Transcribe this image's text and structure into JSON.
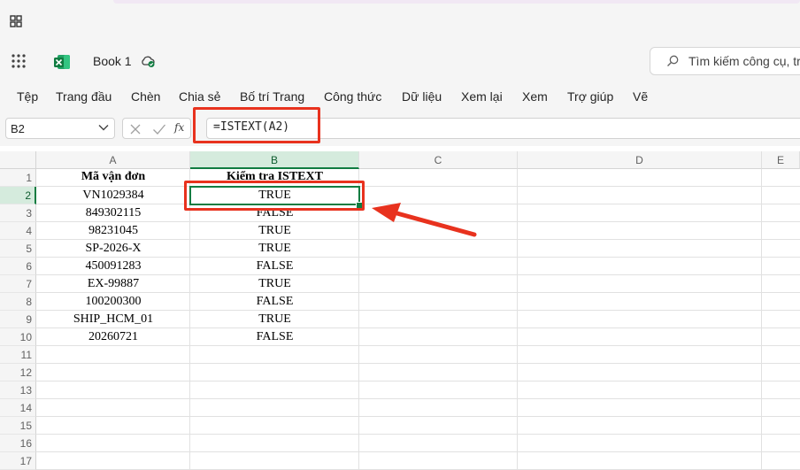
{
  "app": {
    "book_title": "Book 1",
    "search_placeholder": "Tìm kiếm công cụ, tr"
  },
  "ribbon": {
    "tabs": [
      "Tệp",
      "Trang đầu",
      "Chèn",
      "Chia sẻ",
      "Bố trí Trang",
      "Công thức",
      "Dữ liệu",
      "Xem lại",
      "Xem",
      "Trợ giúp",
      "Vẽ"
    ]
  },
  "formula_bar": {
    "name_box": "B2",
    "fx_label": "fx",
    "formula": "=ISTEXT(A2)"
  },
  "sheet": {
    "columns": [
      "A",
      "B",
      "C",
      "D",
      "E"
    ],
    "row_numbers": [
      "1",
      "2",
      "3",
      "4",
      "5",
      "6",
      "7",
      "8",
      "9",
      "10",
      "11",
      "12",
      "13",
      "14",
      "15",
      "16",
      "17"
    ],
    "header": [
      "Mã vận đơn",
      "Kiểm tra ISTEXT"
    ],
    "rows": [
      [
        "VN1029384",
        "TRUE"
      ],
      [
        "849302115",
        "FALSE"
      ],
      [
        "98231045",
        "TRUE"
      ],
      [
        "SP-2026-X",
        "TRUE"
      ],
      [
        "450091283",
        "FALSE"
      ],
      [
        "EX-99887",
        "TRUE"
      ],
      [
        "100200300",
        "FALSE"
      ],
      [
        "SHIP_HCM_01",
        "TRUE"
      ],
      [
        "20260721",
        "FALSE"
      ]
    ],
    "selected_cell": "B2"
  },
  "colors": {
    "accent_green": "#107c41",
    "annotation_red": "#e8321e",
    "chrome_bg": "#f5f5f5"
  },
  "icons": [
    "window-grid-icon",
    "waffle-icon",
    "excel-logo-icon",
    "cloud-sync-icon",
    "search-icon",
    "chevron-down-icon",
    "cancel-icon",
    "confirm-icon",
    "insert-function-icon"
  ]
}
